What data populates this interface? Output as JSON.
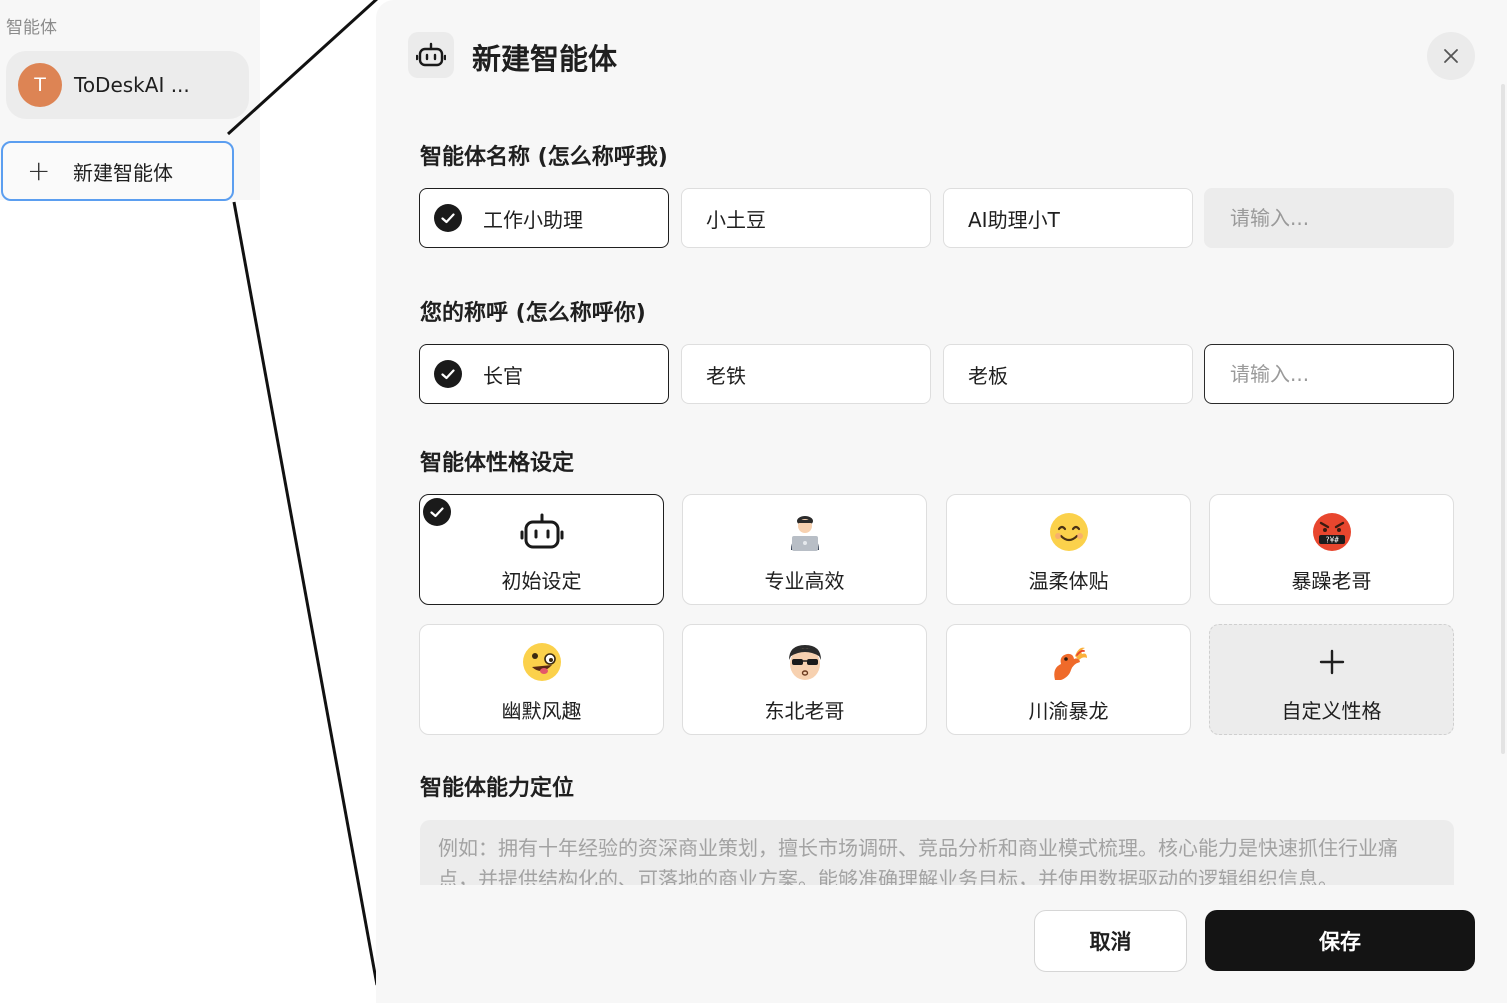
{
  "sidebar": {
    "title": "智能体",
    "agent": {
      "avatar_letter": "T",
      "avatar_color": "#dd8454",
      "name": "ToDeskAI ..."
    },
    "new_agent": {
      "icon": "plus-icon",
      "label": "新建智能体"
    }
  },
  "modal": {
    "header_icon": "robot-icon",
    "title": "新建智能体",
    "close_icon": "close-icon"
  },
  "agent_name": {
    "label": "智能体名称 (怎么称呼我)",
    "options": [
      {
        "label": "工作小助理",
        "selected": true
      },
      {
        "label": "小土豆",
        "selected": false
      },
      {
        "label": "AI助理小T",
        "selected": false
      }
    ],
    "custom_placeholder": "请输入..."
  },
  "user_title": {
    "label": "您的称呼 (怎么称呼你)",
    "options": [
      {
        "label": "长官",
        "selected": true
      },
      {
        "label": "老铁",
        "selected": false
      },
      {
        "label": "老板",
        "selected": false
      }
    ],
    "custom_placeholder": "请输入..."
  },
  "personality": {
    "label": "智能体性格设定",
    "cards": [
      {
        "label": "初始设定",
        "icon": "robot-icon",
        "selected": true
      },
      {
        "label": "专业高效",
        "icon": "laptop-person-icon",
        "selected": false
      },
      {
        "label": "温柔体贴",
        "icon": "smiling-face-icon",
        "selected": false
      },
      {
        "label": "暴躁老哥",
        "icon": "angry-cursing-face-icon",
        "selected": false
      },
      {
        "label": "幽默风趣",
        "icon": "zany-face-icon",
        "selected": false
      },
      {
        "label": "东北老哥",
        "icon": "sunglasses-face-icon",
        "selected": false
      },
      {
        "label": "川渝暴龙",
        "icon": "fire-dragon-icon",
        "selected": false
      },
      {
        "label": "自定义性格",
        "icon": "plus-icon",
        "selected": false
      }
    ]
  },
  "capability": {
    "label": "智能体能力定位",
    "placeholder": "例如：拥有十年经验的资深商业策划，擅长市场调研、竞品分析和商业模式梳理。核心能力是快速抓住行业痛点，并提供结构化的、可落地的商业方案。能够准确理解业务目标，并使用数据驱动的逻辑组织信息。"
  },
  "footer": {
    "cancel_label": "取消",
    "save_label": "保存"
  },
  "colors": {
    "accent_dark": "#141414",
    "sidebar_selection_border": "#5b9ef0",
    "panel_bg": "#f7f7f7"
  }
}
